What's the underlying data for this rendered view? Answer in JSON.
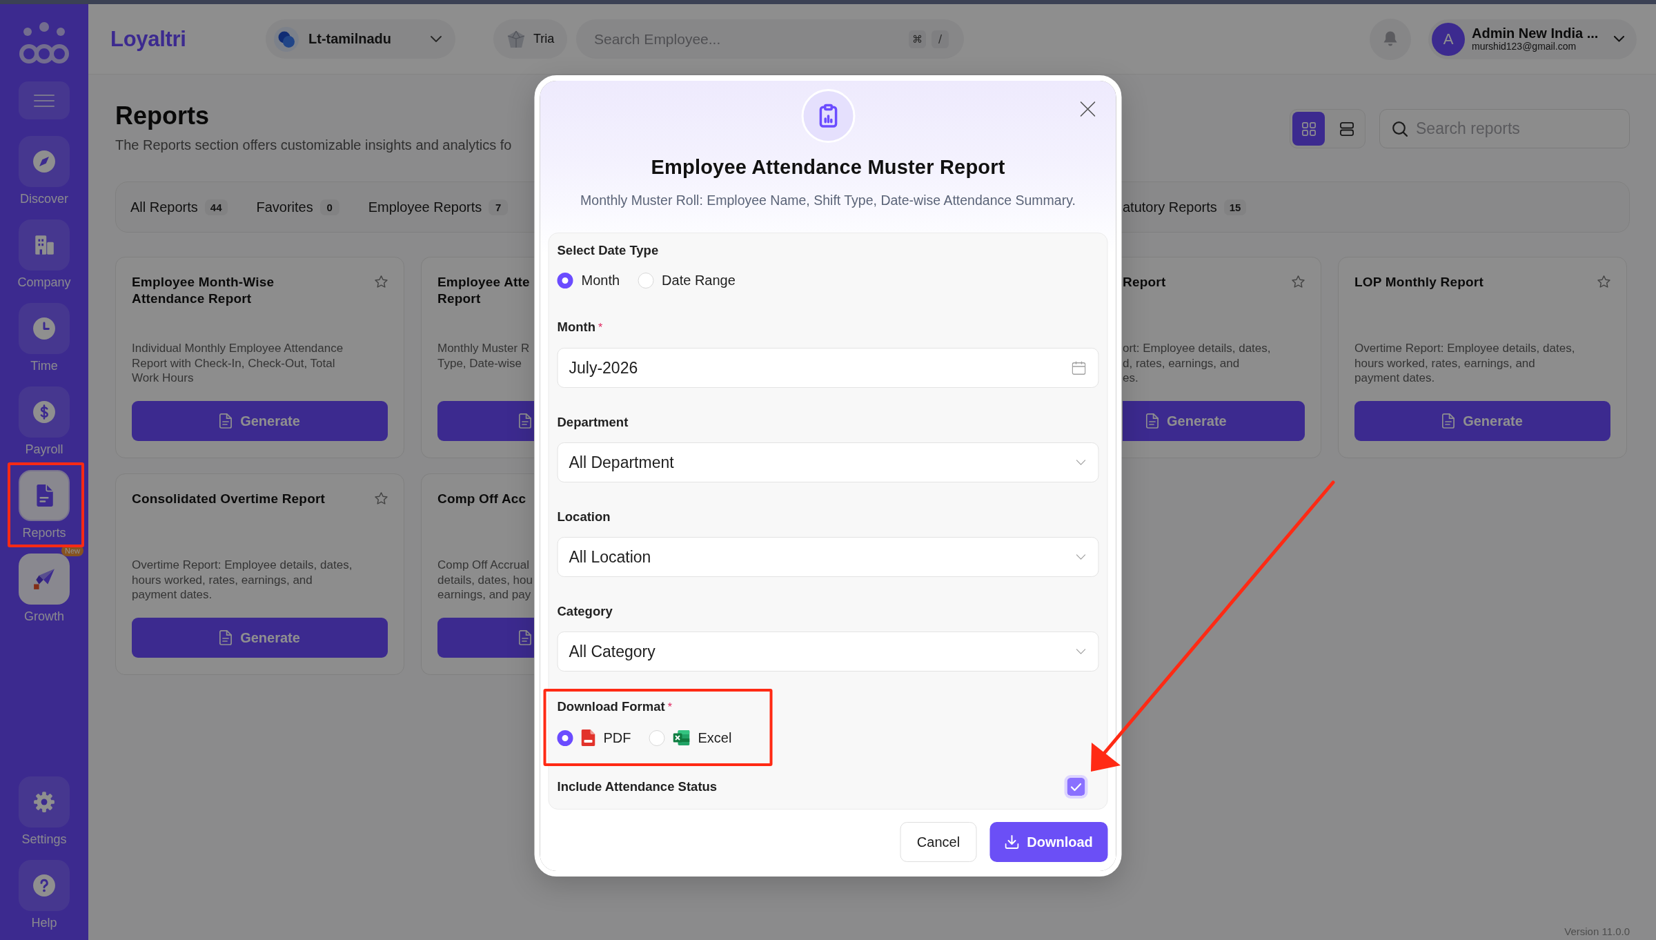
{
  "sidebar": {
    "items": [
      {
        "kind": "nav",
        "label": "Discover",
        "selected": false,
        "annotated": false
      },
      {
        "kind": "nav",
        "label": "Company",
        "selected": false,
        "annotated": false
      },
      {
        "kind": "nav",
        "label": "Time",
        "selected": false,
        "annotated": false
      },
      {
        "kind": "nav",
        "label": "Payroll",
        "selected": false,
        "annotated": false
      },
      {
        "kind": "nav",
        "label": "Reports",
        "selected": true,
        "annotated": true
      },
      {
        "kind": "promo",
        "label": "Growth",
        "selected": false,
        "annotated": false,
        "badge": "New"
      }
    ],
    "bottom_items": [
      {
        "kind": "nav",
        "label": "Settings",
        "selected": false,
        "annotated": false
      },
      {
        "kind": "nav",
        "label": "Help",
        "selected": false,
        "annotated": false
      }
    ]
  },
  "header": {
    "brand": "Loyaltri",
    "company": "Lt-tamilnadu",
    "workspace": "Tria",
    "search": {
      "placeholder": "Search Employee...",
      "keys": [
        "⌘",
        "/"
      ]
    },
    "user": {
      "initial": "A",
      "name": "Admin New India ...",
      "email": "murshid123@gmail.com"
    }
  },
  "page": {
    "title": "Reports",
    "description": "The Reports section offers customizable insights and analytics fo",
    "view_modes": [
      {
        "kind": "grid",
        "selected": true
      },
      {
        "kind": "list",
        "selected": false
      }
    ],
    "search": {
      "placeholder": "Search reports"
    },
    "tabs": [
      {
        "kind": "whole",
        "label": "All Reports",
        "count": "44"
      },
      {
        "kind": "whole",
        "label": "Favorites",
        "count": "0"
      },
      {
        "kind": "whole",
        "label": "Employee Reports",
        "count": "7"
      },
      {
        "kind": "cut_left",
        "label": "atutory Reports",
        "count": "15"
      }
    ],
    "report_rows": [
      {
        "cards": [
          {
            "kind": "whole",
            "title": "Employee Month-Wise Attendance Report",
            "favorite": false,
            "description": "Individual Monthly Employee Attendance Report with Check-In, Check-Out, Total Work Hours",
            "button": "Generate"
          },
          {
            "kind": "cut_right",
            "title_lines": [
              "Employee Atte",
              "Report"
            ],
            "description_lines": [
              "Monthly Muster R",
              "Type, Date-wise"
            ]
          },
          {
            "kind": "cut_left",
            "title_lines": [
              "Report"
            ],
            "favorite": false,
            "description_lines": [
              "ort: Employee details, dates,",
              "d, rates, earnings, and",
              "es."
            ],
            "button": "Generate"
          },
          {
            "kind": "whole",
            "title": "LOP Monthly Report",
            "favorite": false,
            "description": "Overtime Report: Employee details, dates, hours worked, rates, earnings, and payment dates.",
            "button": "Generate"
          }
        ]
      },
      {
        "cards": [
          {
            "kind": "whole",
            "title": "Consolidated Overtime Report",
            "favorite": false,
            "description": "Overtime Report: Employee details, dates, hours worked, rates, earnings, and payment dates.",
            "button": "Generate"
          },
          {
            "kind": "cut_right",
            "title_lines": [
              "Comp Off Acc"
            ],
            "description_lines": [
              "Comp Off Accrual",
              "details, dates, hou",
              "earnings, and pay"
            ]
          }
        ]
      }
    ],
    "version": "Version 11.0.0"
  },
  "dialog": {
    "title": "Employee Attendance Muster Report",
    "subtitle": "Monthly Muster Roll: Employee Name, Shift Type, Date-wise Attendance Summary.",
    "date_type": {
      "label": "Select Date Type",
      "options": [
        {
          "label": "Month",
          "selected": true
        },
        {
          "label": "Date Range",
          "selected": false
        }
      ]
    },
    "fields": [
      {
        "kind": "date",
        "label": "Month",
        "required_mark": "*",
        "value": "July-2026"
      },
      {
        "kind": "select",
        "label": "Department",
        "value": "All Department"
      },
      {
        "kind": "select",
        "label": "Location",
        "value": "All Location"
      },
      {
        "kind": "select",
        "label": "Category",
        "value": "All Category"
      }
    ],
    "download_format": {
      "label": "Download Format",
      "required_mark": "*",
      "annotated": true,
      "options": [
        {
          "kind": "pdf",
          "label": "PDF",
          "selected": true
        },
        {
          "kind": "excel",
          "label": "Excel",
          "selected": false
        }
      ]
    },
    "include_status": {
      "label": "Include Attendance Status",
      "checked": true,
      "pointed": true
    },
    "buttons": [
      {
        "kind": "secondary",
        "label": "Cancel"
      },
      {
        "kind": "primary",
        "label": "Download"
      }
    ]
  }
}
